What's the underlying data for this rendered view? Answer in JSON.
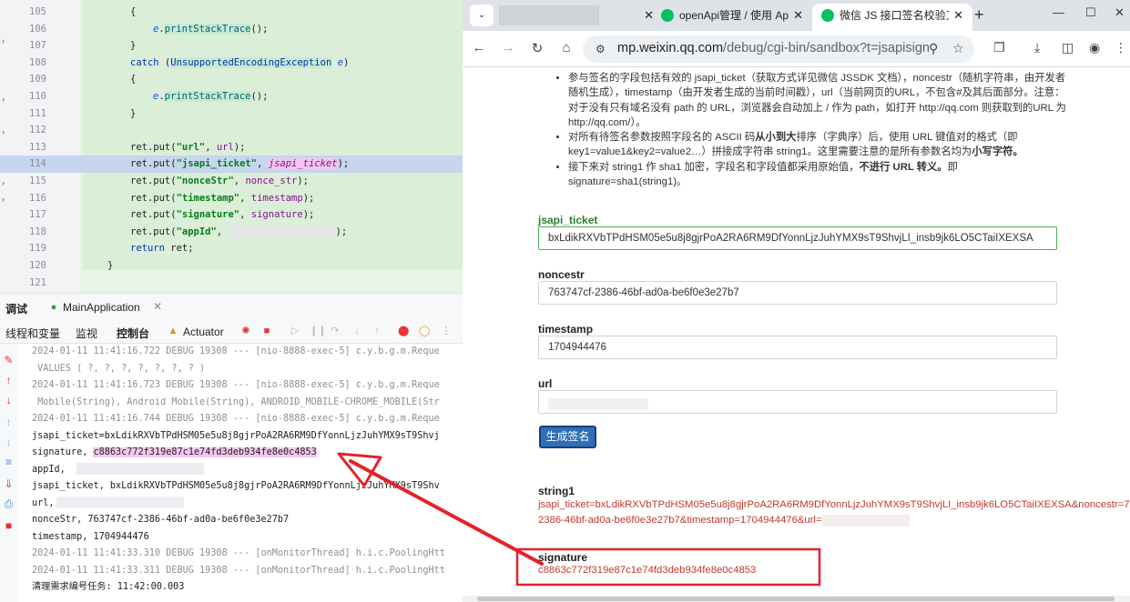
{
  "ide": {
    "gutter_lines": [
      "105",
      "106",
      "107",
      "108",
      "109",
      "110",
      "111",
      "112",
      "113",
      "114",
      "115",
      "116",
      "117",
      "118",
      "119",
      "120",
      "121"
    ],
    "code": {
      "l106_var": "e",
      "l106_method": "printStackTrace",
      "l106_tail": "();",
      "l108_catch": "catch",
      "l108_exception": "UnsupportedEncodingException",
      "l108_var": "e",
      "l110_var": "e",
      "l110_method": "printStackTrace",
      "l110_tail": "();",
      "put_prefix": "ret.put(",
      "put_url_key": "\"url\"",
      "put_url_val": "url",
      "put_ticket_key": "\"jsapi_ticket\"",
      "put_ticket_val": "jsapi_ticket",
      "put_nonce_key": "\"nonceStr\"",
      "put_nonce_val": "nonce_str",
      "put_ts_key": "\"timestamp\"",
      "put_ts_val": "timestamp",
      "put_sig_key": "\"signature\"",
      "put_sig_val": "signature",
      "put_appid_key": "\"appId\"",
      "put_tail": ");",
      "return_kw": "return",
      "return_val": "ret;",
      "brace_open": "{",
      "brace_close": "}"
    },
    "debug_tabs": {
      "debug": "调试",
      "run_config": "MainApplication"
    },
    "toolbar": {
      "threads_vars": "线程和变量",
      "watch": "监视",
      "console": "控制台",
      "actuator": "Actuator"
    },
    "console_lines": [
      "2024-01-11 11:41:16.722 DEBUG 19308 --- [nio-8888-exec-5] c.y.b.g.m.Reque",
      " VALUES ( ?, ?, ?, ?, ?, ?, ? )",
      "2024-01-11 11:41:16.723 DEBUG 19308 --- [nio-8888-exec-5] c.y.b.g.m.Reque",
      " Mobile(String), Android Mobile(String), ANDROID_MOBILE-CHROME_MOBILE(Str",
      "2024-01-11 11:41:16.744 DEBUG 19308 --- [nio-8888-exec-5] c.y.b.g.m.Reque",
      "jsapi_ticket=bxLdikRXVbTPdHSM05e5u8j8gjrPoA2RA6RM9DfYonnLjzJuhYMX9sT9Shvj",
      "signature, ",
      "c8863c772f319e87c1e74fd3deb934fe8e0c4853",
      "appId,",
      "jsapi_ticket, bxLdikRXVbTPdHSM05e5u8j8gjrPoA2RA6RM9DfYonnLjzJuhYMX9sT9Shv",
      "url,",
      "nonceStr, 763747cf-2386-46bf-ad0a-be6f0e3e27b7",
      "timestamp, 1704944476",
      "2024-01-11 11:41:33.310 DEBUG 19308 --- [onMonitorThread] h.i.c.PoolingHtt",
      "2024-01-11 11:41:33.311 DEBUG 19308 --- [onMonitorThread] h.i.c.PoolingHtt",
      "清理需求编号任务: 11:42:00.003"
    ]
  },
  "browser": {
    "tabs": [
      {
        "label": ""
      },
      {
        "label": "openApi管理 / 使用 Ap"
      },
      {
        "label": "微信 JS 接口签名校验工"
      }
    ],
    "new_tab": "+",
    "url_host": "mp.weixin.qq.com",
    "url_path": "/debug/cgi-bin/sandbox?t=jsapisign",
    "window_controls": {
      "minimize": "—",
      "maximize": "☐",
      "close": "✕"
    },
    "bullets": [
      {
        "text_a": "参与签名的字段包括有效的 jsapi_ticket（获取方式详见微信 JSSDK 文档），noncestr（随机字符串，由开发者随机生成），timestamp（由开发者生成的当前时间戳），url（当前网页的URL，不包含#及其后面部分。注意：对于没有只有域名没有 path 的 URL，浏览器会自动加上 / 作为 path，如打开 http://qq.com 则获取到的URL 为 http://qq.com/）。"
      },
      {
        "text_a": "对所有待签名参数按照字段名的 ASCII 码",
        "bold_a": "从小到大",
        "text_b": "排序（字典序）后，使用 URL 键值对的格式（即 key1=value1&key2=value2…）拼接成字符串 string1。这里需要注意的是所有参数名均为",
        "bold_b": "小写字符。"
      },
      {
        "text_a": "接下来对 string1 作 sha1 加密，字段名和字段值都采用原始值，",
        "bold_a": "不进行 URL 转义。",
        "text_b": "即 signature=sha1(string1)。"
      }
    ],
    "form": {
      "jsapi_ticket_label": "jsapi_ticket",
      "jsapi_ticket_value": "bxLdikRXVbTPdHSM05e5u8j8gjrPoA2RA6RM9DfYonnLjzJuhYMX9sT9ShvjLI_insb9jk6LO5CTaiIXEXSA",
      "noncestr_label": "noncestr",
      "noncestr_value": "763747cf-2386-46bf-ad0a-be6f0e3e27b7",
      "timestamp_label": "timestamp",
      "timestamp_value": "1704944476",
      "url_label": "url",
      "url_value": "",
      "generate_button": "生成签名"
    },
    "result": {
      "string1_label": "string1",
      "string1_value_line1": "jsapi_ticket=bxLdikRXVbTPdHSM05e5u8j8gjrPoA2RA6RM9DfYonnLjzJuhYMX9sT9ShvjLI_insb9jk6LO5CTaiIXEXSA&noncestr=763747cf-",
      "string1_value_line2": "2386-46bf-ad0a-be6f0e3e27b7&timestamp=1704944476&url=",
      "signature_label": "signature",
      "signature_value": "c8863c772f319e87c1e74fd3deb934fe8e0c4853"
    }
  },
  "annotation": {
    "color": "#e5222a"
  }
}
